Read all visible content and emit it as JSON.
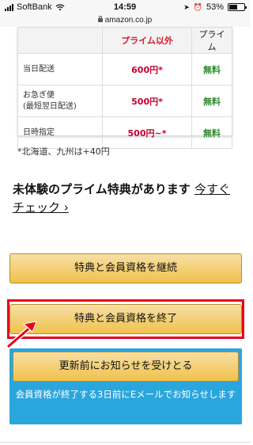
{
  "status_bar": {
    "carrier": "SoftBank",
    "time": "14:59",
    "battery_text": "53%",
    "battery_level": 0.53
  },
  "url_bar": {
    "domain": "amazon.co.jp"
  },
  "shipping_table": {
    "headers": [
      "",
      "プライム以外",
      "プライム"
    ],
    "rows": [
      {
        "label": "当日配送",
        "non_prime": "600円*",
        "prime": "無料"
      },
      {
        "label": "お急ぎ便\n(最短翌日配送)",
        "non_prime": "500円*",
        "prime": "無料"
      },
      {
        "label": "日時指定",
        "non_prime": "500円~*",
        "prime": "無料"
      }
    ]
  },
  "note": "*北海道、九州は+40円",
  "promo": {
    "text": "未体験のプライム特典があります",
    "link": "今すぐチェック ›"
  },
  "buttons": {
    "continue": "特典と会員資格を継続",
    "end": "特典と会員資格を終了",
    "notify": "更新前にお知らせを受けとる"
  },
  "notify_description": "会員資格が終了する3日前にEメールでお知らせします",
  "colors": {
    "highlight": "#e8001c",
    "button_top": "#f7dfa5",
    "button_bottom": "#f0c14b",
    "notify_panel": "#2ba6dd",
    "price_red": "#c4002c",
    "free_green": "#2e8b2e"
  }
}
